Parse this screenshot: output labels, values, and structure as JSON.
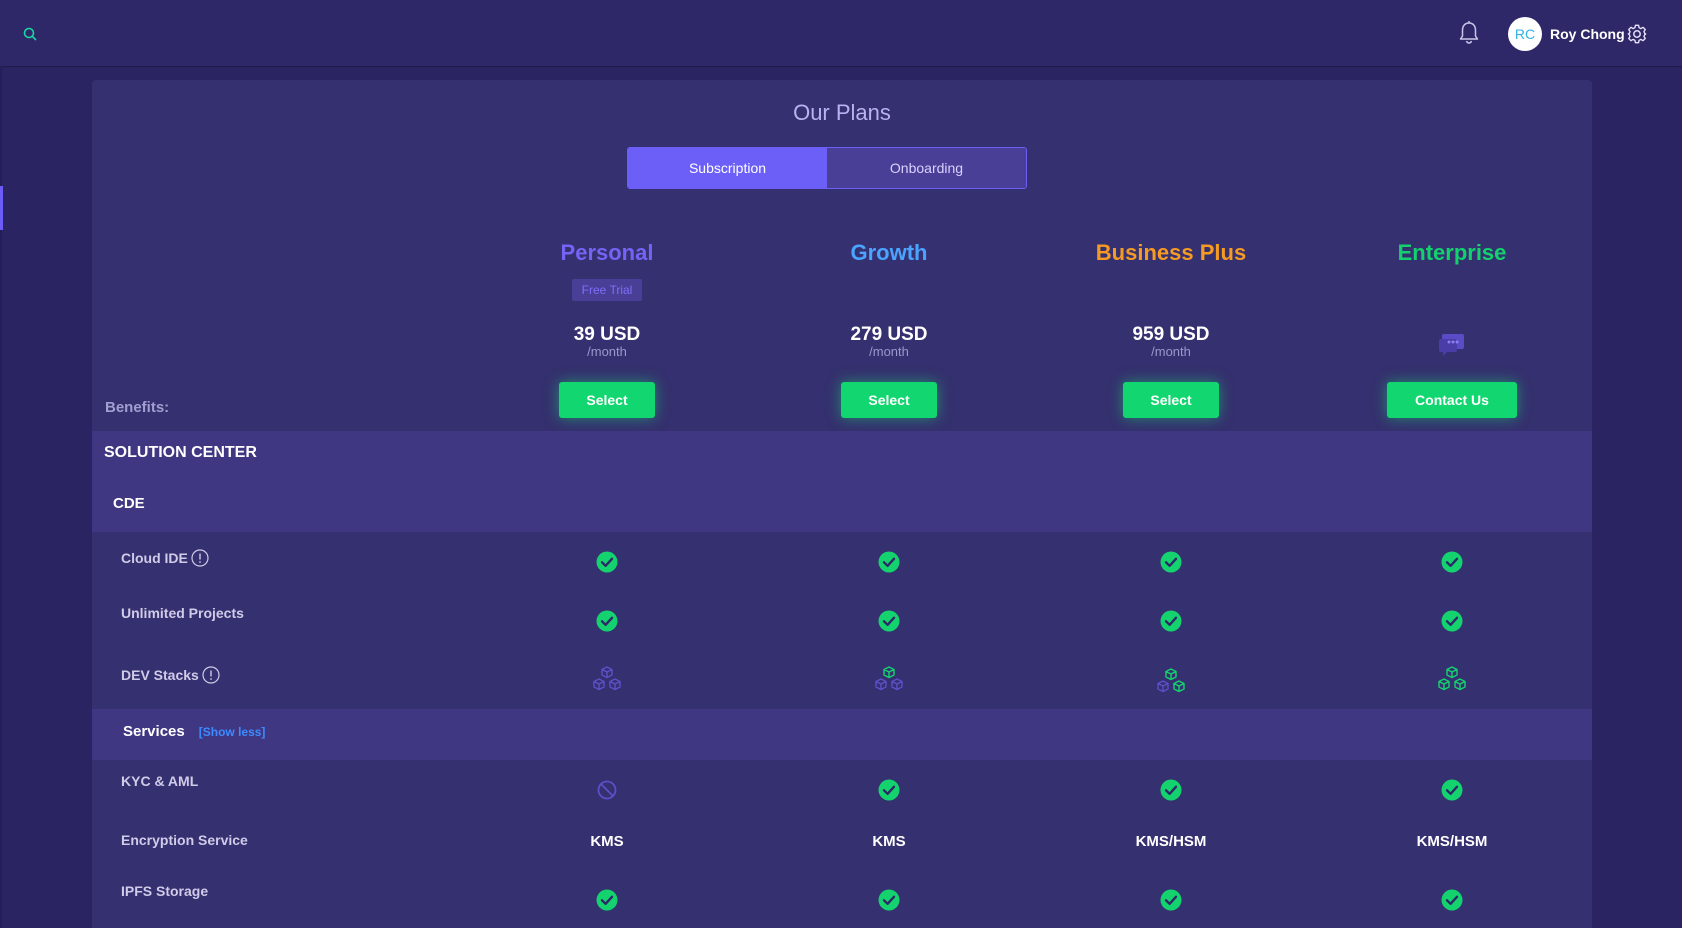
{
  "header": {
    "user_initials": "RC",
    "user_name": "Roy Chong"
  },
  "page": {
    "title": "Our Plans",
    "tabs": [
      {
        "label": "Subscription",
        "active": true
      },
      {
        "label": "Onboarding",
        "active": false
      }
    ],
    "benefits_label": "Benefits:"
  },
  "plans": [
    {
      "name": "Personal",
      "color": "#7563f5",
      "badge": "Free Trial",
      "price": "39 USD",
      "period": "/month",
      "button": "Select"
    },
    {
      "name": "Growth",
      "color": "#4aa3ff",
      "badge": "",
      "price": "279 USD",
      "period": "/month",
      "button": "Select"
    },
    {
      "name": "Business Plus",
      "color": "#f59a23",
      "badge": "",
      "price": "959 USD",
      "period": "/month",
      "button": "Select"
    },
    {
      "name": "Enterprise",
      "color": "#13d26d",
      "badge": "",
      "price": "",
      "period": "",
      "button": "Contact Us"
    }
  ],
  "sections": {
    "solution_center": "SOLUTION CENTER",
    "cde": "CDE",
    "services": "Services",
    "show_less": "[Show less]"
  },
  "rows": {
    "cloud_ide": {
      "label": "Cloud IDE",
      "values": [
        "check",
        "check",
        "check",
        "check"
      ]
    },
    "unlimited_projects": {
      "label": "Unlimited Projects",
      "values": [
        "check",
        "check",
        "check",
        "check"
      ]
    },
    "dev_stacks": {
      "label": "DEV Stacks",
      "values": [
        "stacks-1",
        "stacks-1",
        "stacks-2",
        "stacks-3"
      ]
    },
    "kyc_aml": {
      "label": "KYC & AML",
      "values": [
        "blocked",
        "check",
        "check",
        "check"
      ]
    },
    "encryption": {
      "label": "Encryption Service",
      "values": [
        "KMS",
        "KMS",
        "KMS/HSM",
        "KMS/HSM"
      ]
    },
    "ipfs": {
      "label": "IPFS Storage",
      "values": [
        "check",
        "check",
        "check",
        "check"
      ]
    }
  },
  "colors": {
    "accent": "#6c5ff8",
    "green": "#12d66f",
    "background": "#2a2463",
    "panel": "#35306f",
    "band": "#3f3782"
  }
}
